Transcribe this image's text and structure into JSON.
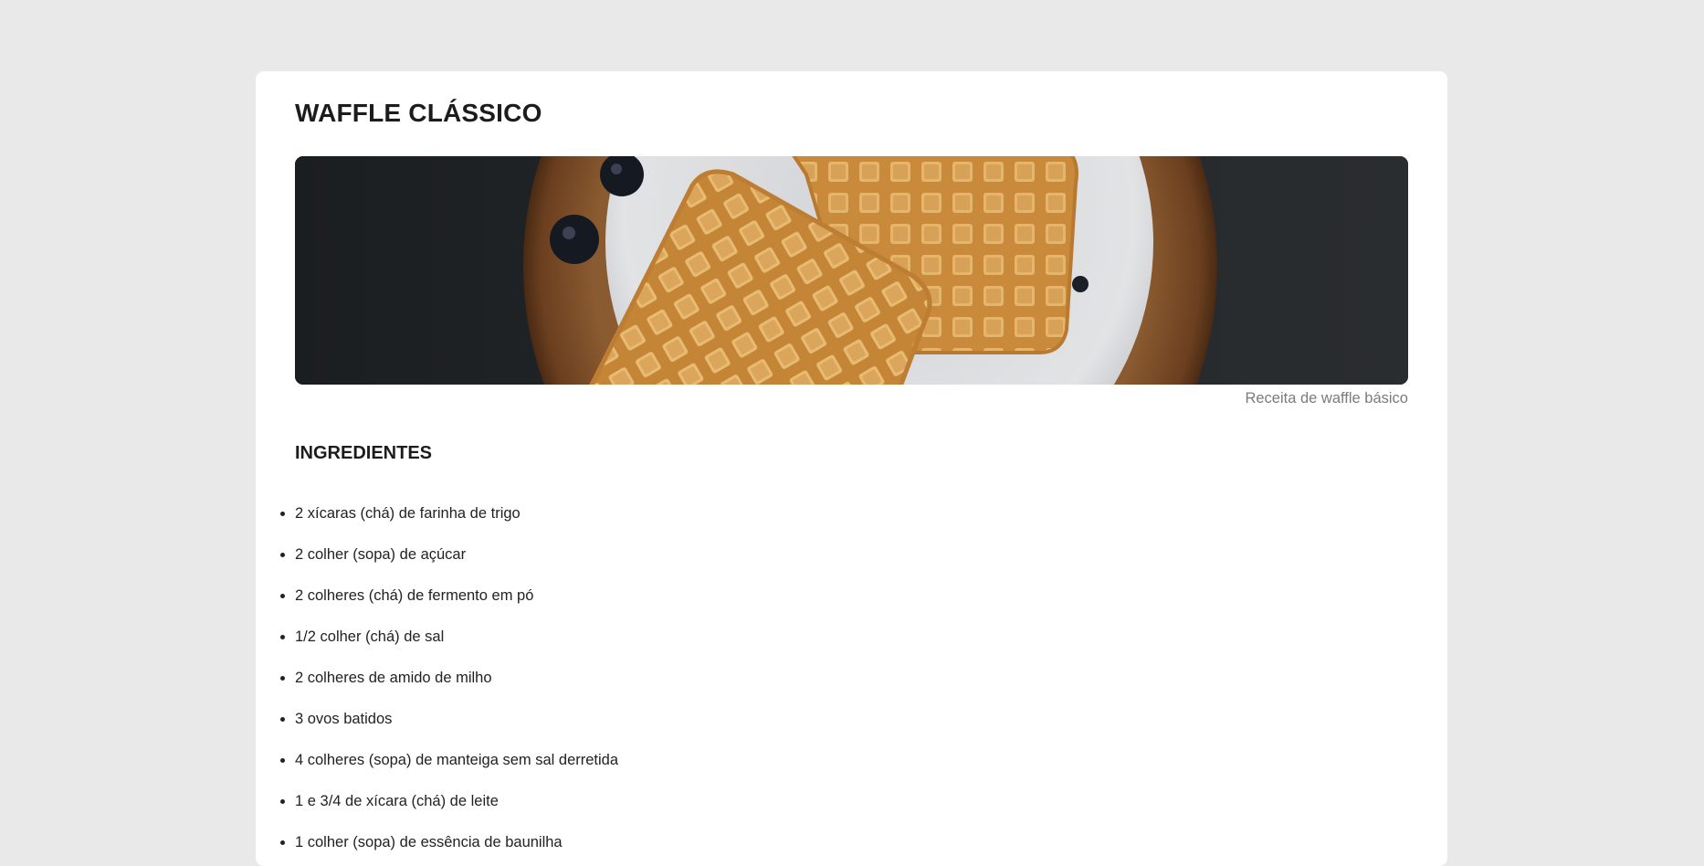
{
  "recipe": {
    "title": "WAFFLE CLÁSSICO",
    "image_caption": "Receita de waffle básico",
    "ingredients_heading": "INGREDIENTES",
    "ingredients": [
      "2 xícaras (chá) de farinha de trigo",
      "2 colher (sopa) de açúcar",
      "2 colheres (chá) de fermento em pó",
      "1/2 colher (chá) de sal",
      "2 colheres de amido de milho",
      "3 ovos batidos",
      "4 colheres (sopa) de manteiga sem sal derretida",
      "1 e 3/4 de xícara (chá) de leite",
      "1 colher (sopa) de essência de baunilha"
    ]
  },
  "colors": {
    "page_background": "#e9e9e9",
    "card_background": "#ffffff",
    "caption_text": "#7b7b7b",
    "waffle": "#d99b45",
    "plate": "#dfe0e2",
    "board": "#7a4a26"
  }
}
